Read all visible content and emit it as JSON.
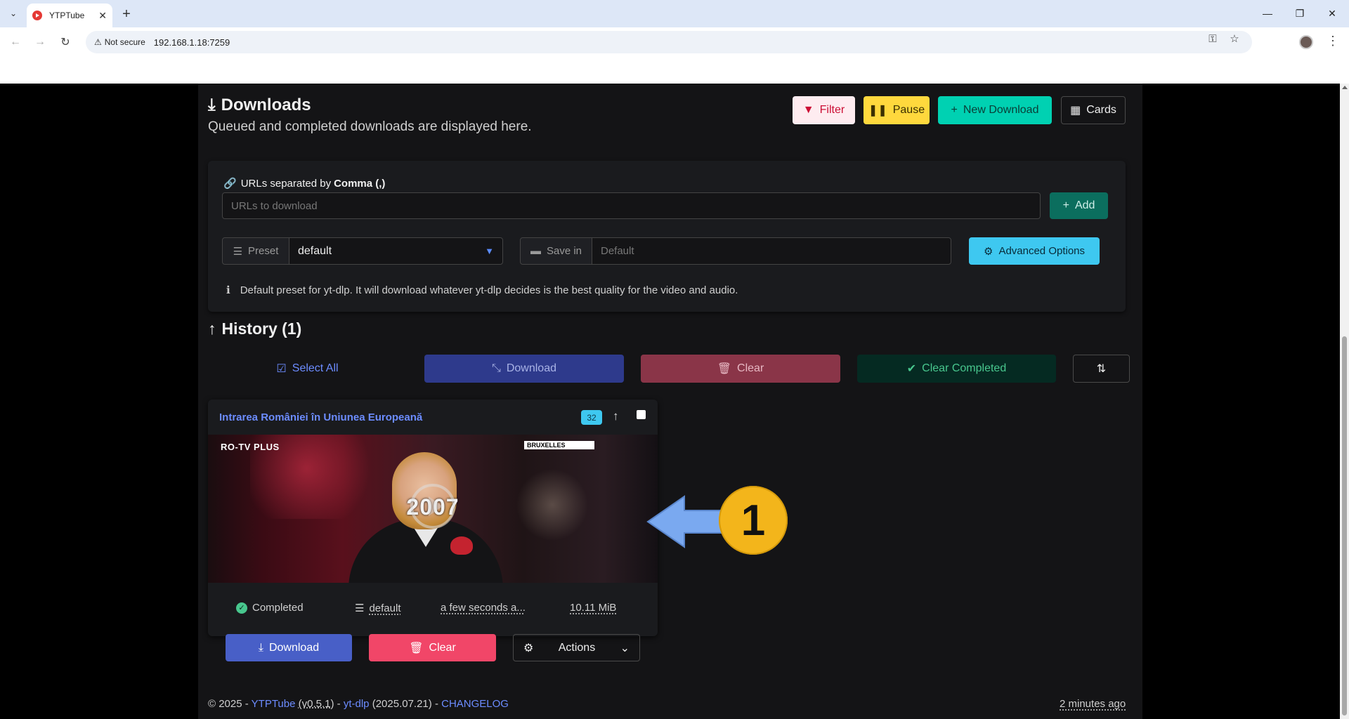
{
  "browser": {
    "tab_title": "YTPTube",
    "tab_close": "✕",
    "new_tab": "+",
    "security_label": "Not secure",
    "url": "192.168.1.18:7259"
  },
  "header": {
    "title": "Downloads",
    "subtitle": "Queued and completed downloads are displayed here.",
    "filter_label": "Filter",
    "pause_label": "Pause",
    "new_download_label": "New Download",
    "cards_label": "Cards"
  },
  "form": {
    "urls_label_prefix": "URLs separated by ",
    "urls_label_bold": "Comma (,)",
    "urls_placeholder": "URLs to download",
    "add_label": "Add",
    "preset_label": "Preset",
    "preset_value": "default",
    "save_in_label": "Save in",
    "save_in_placeholder": "Default",
    "advanced_label": "Advanced Options",
    "help_text": "Default preset for yt-dlp. It will download whatever yt-dlp decides is the best quality for the video and audio."
  },
  "history": {
    "title": "History (1)",
    "select_all": "Select All",
    "download": "Download",
    "clear": "Clear",
    "clear_completed": "Clear Completed"
  },
  "card": {
    "title": "Intrarea României în Uniunea Europeană",
    "badge": "32",
    "thumb_logo_left": "RO-TV PLUS",
    "thumb_logo_right": "BRUXELLES",
    "thumb_year": "2007",
    "status": "Completed",
    "preset": "default",
    "time": "a few seconds a...",
    "size": "10.11 MiB",
    "download_label": "Download",
    "clear_label": "Clear",
    "actions_label": "Actions"
  },
  "footer": {
    "copyright": "© 2025 - ",
    "app_name": "YTPTube",
    "app_version": "(v0.5.1)",
    "sep1": " - ",
    "ytdlp": "yt-dlp",
    "ytdlp_version": "(2025.07.21)",
    "sep2": " - ",
    "changelog": "CHANGELOG",
    "updated": "2 minutes ago"
  },
  "annotation": {
    "number": "1",
    "arrow_color": "#7aa9f0",
    "circle_color": "#f3b51b"
  },
  "colors": {
    "primary": "#485fc7",
    "danger": "#f14668",
    "success": "#48c78e",
    "info": "#3ec8f0",
    "warning": "#ffd83d",
    "teal": "#00d1b2"
  }
}
